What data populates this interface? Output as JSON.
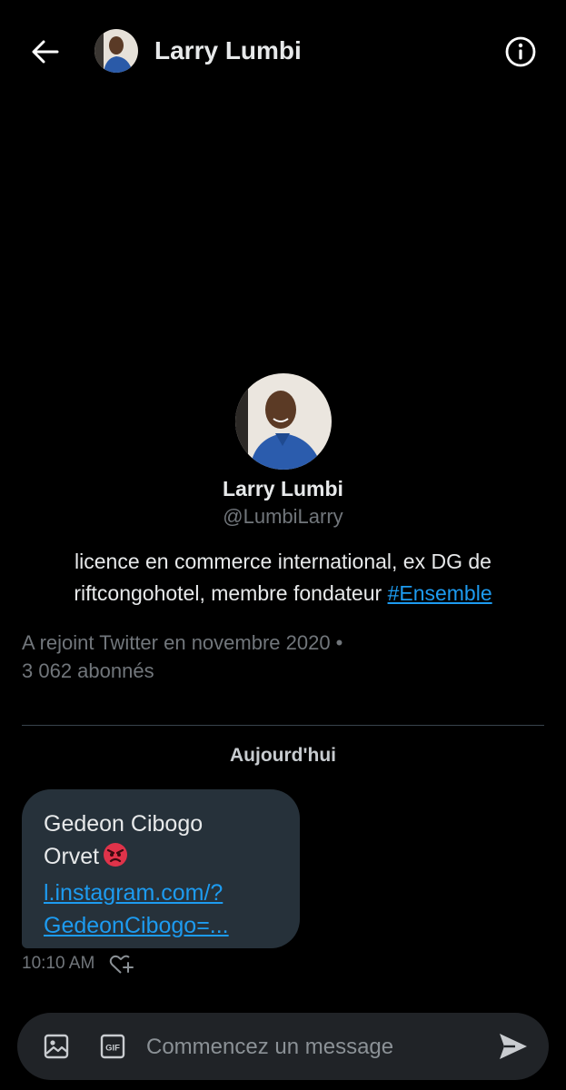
{
  "header": {
    "name": "Larry Lumbi",
    "back_icon": "arrow-left-icon",
    "info_icon": "info-circle-icon"
  },
  "profile": {
    "name": "Larry Lumbi",
    "handle": "@LumbiLarry",
    "bio_text": "licence en commerce international, ex DG de riftcongohotel, membre fondateur ",
    "bio_hashtag": "#Ensemble",
    "joined": "A rejoint Twitter en novembre 2020 •",
    "followers": "3 062 abonnés"
  },
  "conversation": {
    "date_separator": "Aujourd'hui",
    "messages": [
      {
        "line1": "Gedeon Cibogo",
        "line2": "Orvet",
        "emoji": "angry-face-icon",
        "link_line1": "l.instagram.com/?",
        "link_line2": "GedeonCibogo=...",
        "time": "10:10 AM"
      }
    ]
  },
  "composer": {
    "placeholder": "Commencez un message",
    "media_icon": "image-icon",
    "gif_icon": "gif-icon",
    "send_icon": "send-icon"
  },
  "colors": {
    "background": "#000000",
    "accent": "#1d9bf0",
    "bubble": "#26313a",
    "muted_text": "#71767b"
  }
}
